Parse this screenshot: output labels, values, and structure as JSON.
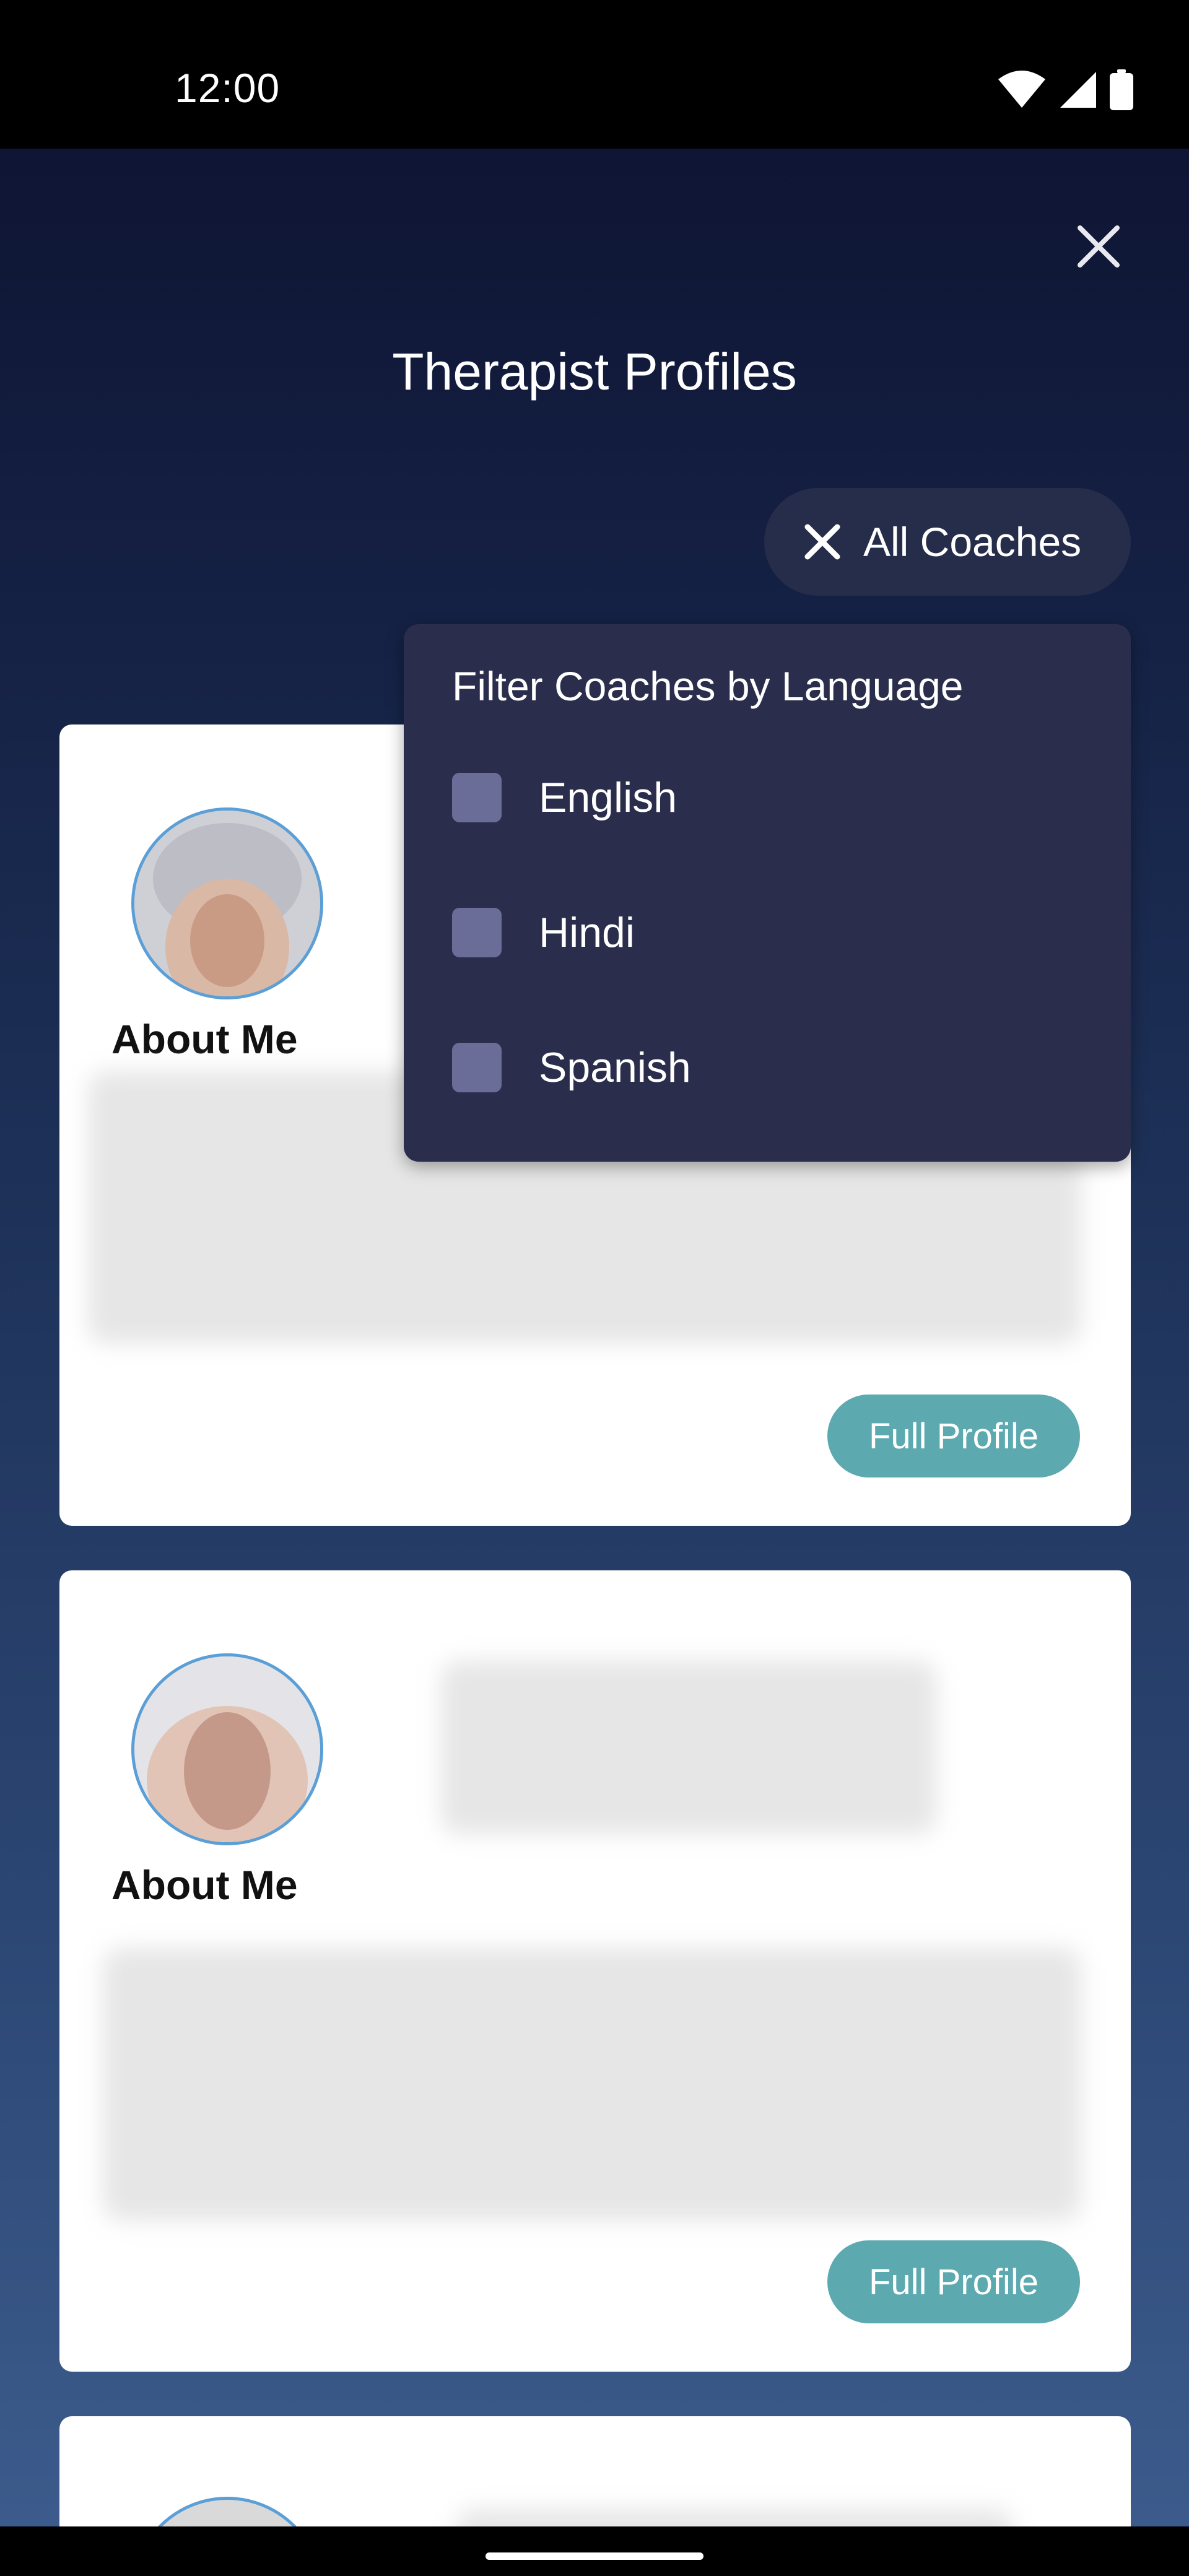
{
  "status_bar": {
    "time": "12:00",
    "icons": [
      "wifi-icon",
      "signal-icon",
      "battery-icon"
    ]
  },
  "header": {
    "title": "Therapist Profiles",
    "close_icon": "close-icon"
  },
  "filter_chip": {
    "label": "All Coaches",
    "icon": "close-icon"
  },
  "filter_panel": {
    "title": "Filter Coaches by Language",
    "options": [
      {
        "label": "English",
        "checked": false
      },
      {
        "label": "Hindi",
        "checked": false
      },
      {
        "label": "Spanish",
        "checked": false
      }
    ]
  },
  "cards": [
    {
      "about_label": "About Me",
      "button_label": "Full Profile"
    },
    {
      "about_label": "About Me",
      "button_label": "Full Profile"
    }
  ],
  "colors": {
    "accent_button": "#5ca9b0",
    "panel_bg": "#2a2d4b",
    "checkbox": "#6b6d99",
    "avatar_ring": "#5b9fd6"
  }
}
